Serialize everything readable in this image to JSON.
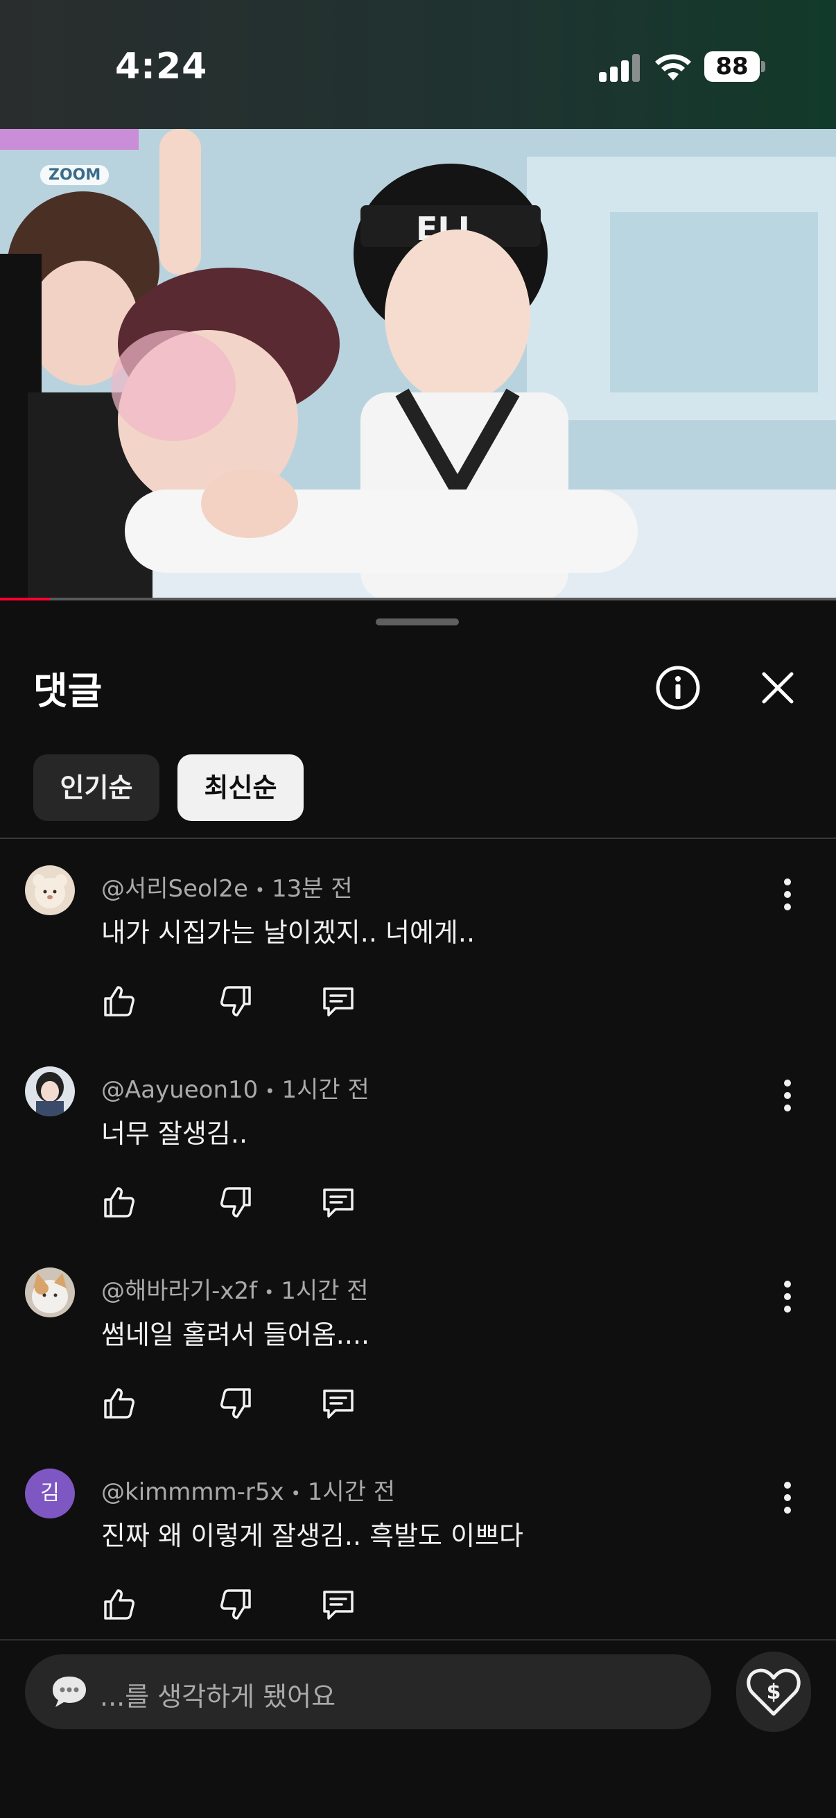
{
  "status_bar": {
    "time": "4:24",
    "battery": "88"
  },
  "video": {
    "badge": "ZOOM",
    "progress_fraction": 0.06
  },
  "comments_sheet": {
    "title": "댓글",
    "sort_chips": [
      {
        "label": "인기순",
        "selected": false
      },
      {
        "label": "최신순",
        "selected": true
      }
    ],
    "comments": [
      {
        "author": "@서리Seol2e",
        "time": "13분 전",
        "text": "내가 시집가는 날이겠지.. 너에게.."
      },
      {
        "author": "@Aayueon10",
        "time": "1시간 전",
        "text": "너무 잘생김.."
      },
      {
        "author": "@해바라기-x2f",
        "time": "1시간 전",
        "text": "썸네일 홀려서 들어옴...."
      },
      {
        "author": "@kimmmm-r5x",
        "time": "1시간 전",
        "text": "진짜 왜 이렇게 잘생김.. 흑발도 이쁘다",
        "avatar_letter": "김"
      }
    ]
  },
  "input": {
    "placeholder": "...를 생각하게 됐어요"
  },
  "colors": {
    "background": "#0f0f0f",
    "chip_selected": "#f1f1f1",
    "chip_default": "#272727",
    "secondary_text": "#aaaaaa",
    "progress": "#ff0033"
  }
}
